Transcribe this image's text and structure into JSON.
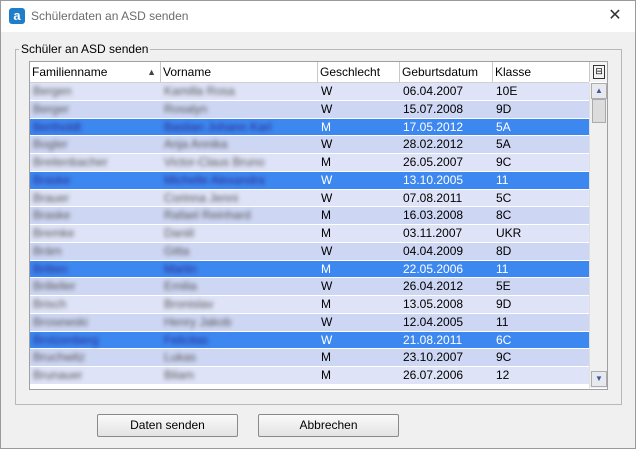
{
  "window": {
    "title": "Schülerdaten an ASD senden",
    "app_icon_letter": "a",
    "close_glyph": "✕"
  },
  "group": {
    "legend": "Schüler an ASD senden"
  },
  "table": {
    "columns": [
      "Familienname",
      "Vorname",
      "Geschlecht",
      "Geburtsdatum",
      "Klasse"
    ],
    "sort": {
      "column": "Familienname",
      "direction": "ascending",
      "glyph": "▲"
    },
    "column_chooser_glyph": "⊟",
    "rows": [
      {
        "family": "Bergen",
        "first": "Kamilla Rosa",
        "gender": "W",
        "dob": "06.04.2007",
        "cls": "10E",
        "selected": false
      },
      {
        "family": "Berger",
        "first": "Rosalyn",
        "gender": "W",
        "dob": "15.07.2008",
        "cls": "9D",
        "selected": false
      },
      {
        "family": "Bertholdt",
        "first": "Bastian Johann Karl",
        "gender": "M",
        "dob": "17.05.2012",
        "cls": "5A",
        "selected": true
      },
      {
        "family": "Bogler",
        "first": "Anja Annika",
        "gender": "W",
        "dob": "28.02.2012",
        "cls": "5A",
        "selected": false
      },
      {
        "family": "Breitenbacher",
        "first": "Victor-Claus Bruno",
        "gender": "M",
        "dob": "26.05.2007",
        "cls": "9C",
        "selected": false
      },
      {
        "family": "Braske",
        "first": "Michelle Alexandra",
        "gender": "W",
        "dob": "13.10.2005",
        "cls": "11",
        "selected": true
      },
      {
        "family": "Brauer",
        "first": "Corinna Jenni",
        "gender": "W",
        "dob": "07.08.2011",
        "cls": "5C",
        "selected": false
      },
      {
        "family": "Braske",
        "first": "Rafael Reinhard",
        "gender": "M",
        "dob": "16.03.2008",
        "cls": "8C",
        "selected": false
      },
      {
        "family": "Bremke",
        "first": "Daniil",
        "gender": "M",
        "dob": "03.11.2007",
        "cls": "UKR",
        "selected": false
      },
      {
        "family": "Bräm",
        "first": "Gitta",
        "gender": "W",
        "dob": "04.04.2009",
        "cls": "8D",
        "selected": false
      },
      {
        "family": "Britten",
        "first": "Marlin",
        "gender": "M",
        "dob": "22.05.2006",
        "cls": "11",
        "selected": true
      },
      {
        "family": "Brilleller",
        "first": "Emilia",
        "gender": "W",
        "dob": "26.04.2012",
        "cls": "5E",
        "selected": false
      },
      {
        "family": "Brisch",
        "first": "Bronislav",
        "gender": "M",
        "dob": "13.05.2008",
        "cls": "9D",
        "selected": false
      },
      {
        "family": "Brosewski",
        "first": "Henry Jakob",
        "gender": "W",
        "dob": "12.04.2005",
        "cls": "11",
        "selected": false
      },
      {
        "family": "Brotzenberg",
        "first": "Felicitas",
        "gender": "W",
        "dob": "21.08.2011",
        "cls": "6C",
        "selected": true
      },
      {
        "family": "Bruchwitz",
        "first": "Lukas",
        "gender": "M",
        "dob": "23.10.2007",
        "cls": "9C",
        "selected": false
      },
      {
        "family": "Brunauer",
        "first": "Bilam",
        "gender": "M",
        "dob": "26.07.2006",
        "cls": "12",
        "selected": false
      }
    ]
  },
  "buttons": {
    "send": "Daten senden",
    "cancel": "Abbrechen"
  },
  "colors": {
    "row_odd": "#dfe3f7",
    "row_even": "#cdd6f3",
    "row_selected": "#3d87f0",
    "selection_text": "#ffffff"
  },
  "scrollbar": {
    "up_glyph": "▲",
    "down_glyph": "▼"
  }
}
